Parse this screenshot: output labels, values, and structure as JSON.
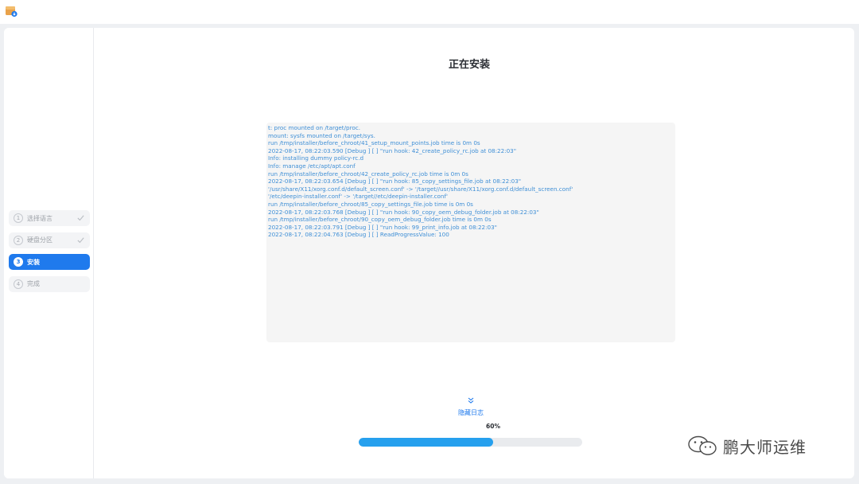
{
  "app": {
    "icon": "installer-package-icon"
  },
  "sidebar": {
    "steps": [
      {
        "number": "1",
        "label": "选择语言",
        "done": true
      },
      {
        "number": "2",
        "label": "硬盘分区",
        "done": true
      },
      {
        "number": "3",
        "label": "安装",
        "active": true
      },
      {
        "number": "4",
        "label": "完成"
      }
    ]
  },
  "main": {
    "title": "正在安装",
    "log_lines": [
      "t: proc mounted on /target/proc.",
      "mount: sysfs mounted on /target/sys.",
      "run /tmp/installer/before_chroot/41_setup_mount_points.job time is 0m 0s",
      "2022-08-17, 08:22:03.590 [Debug  ] [  ] \"run hook: 42_create_policy_rc.job at 08:22:03\"",
      "Info: installing dummy policy-rc.d",
      "Info: manage /etc/apt/apt.conf",
      "run /tmp/installer/before_chroot/42_create_policy_rc.job time is 0m 0s",
      "2022-08-17, 08:22:03.654 [Debug  ] [  ] \"run hook: 85_copy_settings_file.job at 08:22:03\"",
      "'/usr/share/X11/xorg.conf.d/default_screen.conf' -> '/target//usr/share/X11/xorg.conf.d/default_screen.conf'",
      "'/etc/deepin-installer.conf' -> '/target//etc/deepin-installer.conf'",
      "run /tmp/installer/before_chroot/85_copy_settings_file.job time is 0m 0s",
      "2022-08-17, 08:22:03.768 [Debug  ] [  ] \"run hook: 90_copy_oem_debug_folder.job at 08:22:03\"",
      "run /tmp/installer/before_chroot/90_copy_oem_debug_folder.job time is 0m 0s",
      "2022-08-17, 08:22:03.791 [Debug  ] [  ] \"run hook: 99_print_info.job at 08:22:03\"",
      "2022-08-17, 08:22:04.763 [Debug  ] [  ] ReadProgressValue:  100"
    ],
    "hide_log_label": "隐藏日志",
    "progress": {
      "percent_label": "60%",
      "value": 0.6
    },
    "accent_color": "#1f7aed",
    "progress_color": "#26a0ee",
    "log_color": "#3f8fd6"
  },
  "watermark": {
    "text": "鹏大师运维",
    "icon": "wechat-icon"
  }
}
